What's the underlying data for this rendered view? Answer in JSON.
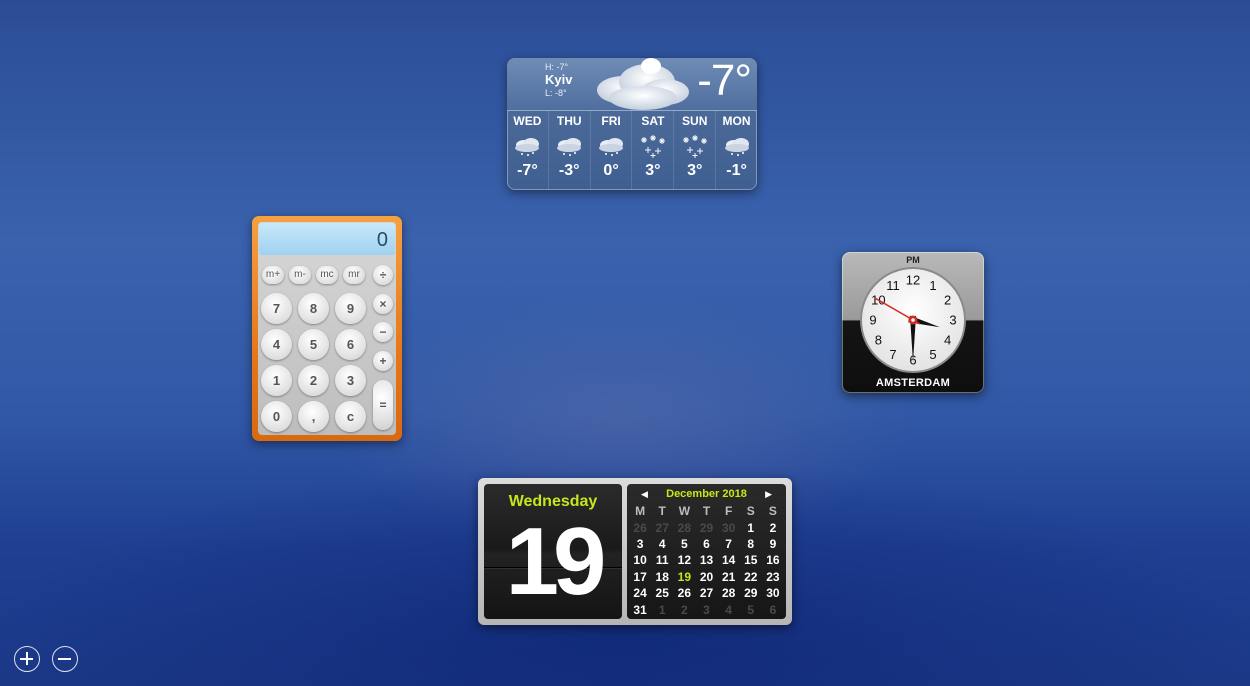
{
  "weather": {
    "city": "Kyiv",
    "high": "H: -7°",
    "low": "L: -8°",
    "current": "-7°",
    "forecast": [
      {
        "day": "WED",
        "temp": "-7°",
        "icon": "snow-cloud-icon"
      },
      {
        "day": "THU",
        "temp": "-3°",
        "icon": "snow-cloud-icon"
      },
      {
        "day": "FRI",
        "temp": "0°",
        "icon": "snow-cloud-icon"
      },
      {
        "day": "SAT",
        "temp": "3°",
        "icon": "snowflakes-icon"
      },
      {
        "day": "SUN",
        "temp": "3°",
        "icon": "snowflakes-icon"
      },
      {
        "day": "MON",
        "temp": "-1°",
        "icon": "snow-cloud-icon"
      }
    ]
  },
  "calculator": {
    "display": "0",
    "memory": [
      "m+",
      "m-",
      "mc",
      "mr"
    ],
    "divide": "÷",
    "multiply": "×",
    "minus": "−",
    "plus": "+",
    "equals": "=",
    "digits": [
      "7",
      "8",
      "9",
      "4",
      "5",
      "6",
      "1",
      "2",
      "3",
      "0",
      ",",
      "c"
    ]
  },
  "clock": {
    "ampm": "PM",
    "city": "AMSTERDAM",
    "numbers": [
      "12",
      "1",
      "2",
      "3",
      "4",
      "5",
      "6",
      "7",
      "8",
      "9",
      "10",
      "11"
    ],
    "hour": 3,
    "minute": 30,
    "second": 50
  },
  "calendar": {
    "weekday": "Wednesday",
    "day": "19",
    "month_title": "December 2018",
    "headers": [
      "M",
      "T",
      "W",
      "T",
      "F",
      "S",
      "S"
    ],
    "weeks": [
      [
        "26",
        "27",
        "28",
        "29",
        "30",
        "1",
        "2"
      ],
      [
        "3",
        "4",
        "5",
        "6",
        "7",
        "8",
        "9"
      ],
      [
        "10",
        "11",
        "12",
        "13",
        "14",
        "15",
        "16"
      ],
      [
        "17",
        "18",
        "19",
        "20",
        "21",
        "22",
        "23"
      ],
      [
        "24",
        "25",
        "26",
        "27",
        "28",
        "29",
        "30"
      ],
      [
        "31",
        "1",
        "2",
        "3",
        "4",
        "5",
        "6"
      ]
    ],
    "today": "19",
    "accent": "#c7e61b"
  },
  "controls": {
    "add_icon": "plus-circle-icon",
    "remove_icon": "minus-circle-icon"
  }
}
